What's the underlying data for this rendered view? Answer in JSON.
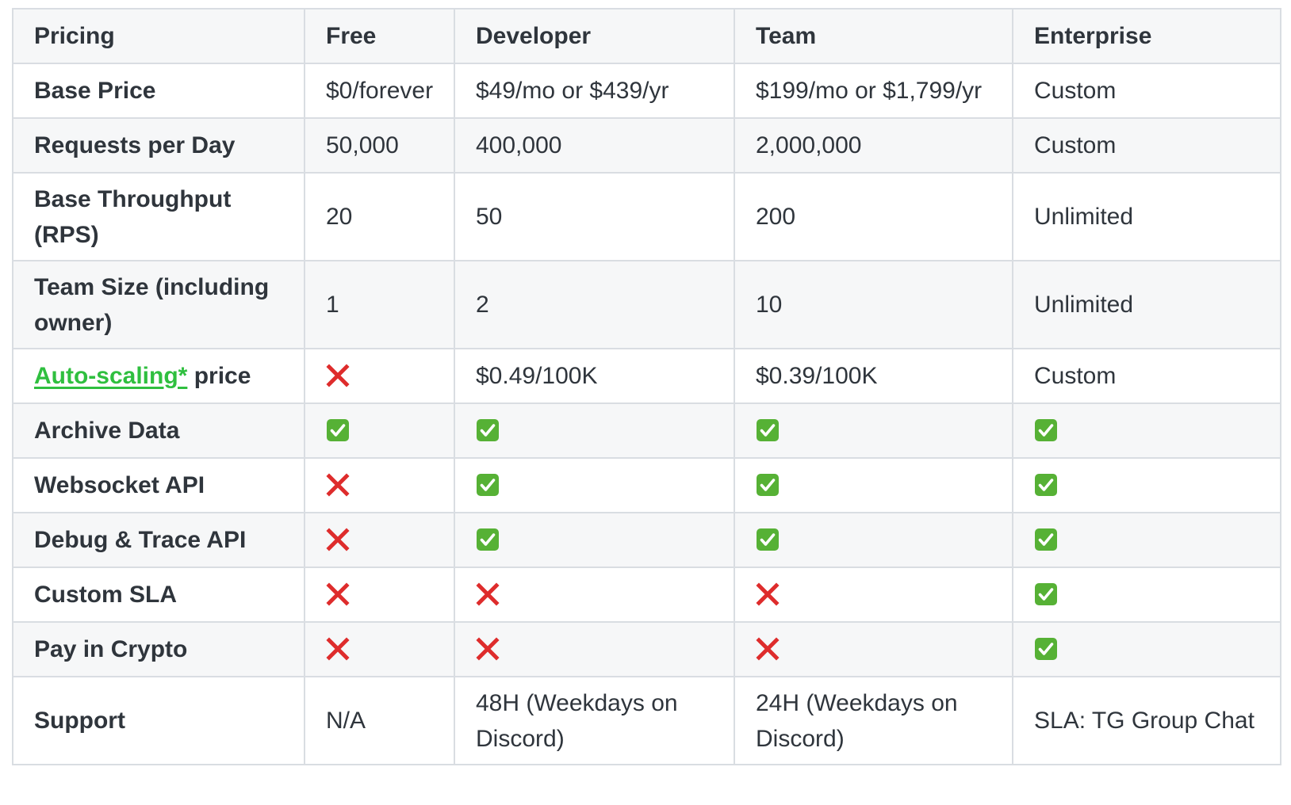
{
  "table": {
    "headers": [
      "Pricing",
      "Free",
      "Developer",
      "Team",
      "Enterprise"
    ],
    "rows": [
      {
        "label": "Base Price",
        "cells": [
          {
            "text": "$0/forever"
          },
          {
            "text": "$49/mo or $439/yr"
          },
          {
            "text": "$199/mo or $1,799/yr"
          },
          {
            "text": "Custom"
          }
        ]
      },
      {
        "label": "Requests per Day",
        "cells": [
          {
            "text": "50,000"
          },
          {
            "text": "400,000"
          },
          {
            "text": "2,000,000"
          },
          {
            "text": "Custom"
          }
        ]
      },
      {
        "label": "Base Throughput (RPS)",
        "cells": [
          {
            "text": "20"
          },
          {
            "text": "50"
          },
          {
            "text": "200"
          },
          {
            "text": "Unlimited"
          }
        ]
      },
      {
        "label": "Team Size (including owner)",
        "cells": [
          {
            "text": "1"
          },
          {
            "text": "2"
          },
          {
            "text": "10"
          },
          {
            "text": "Unlimited"
          }
        ]
      },
      {
        "label_link": "Auto-scaling*",
        "label_suffix": " price",
        "cells": [
          {
            "icon": "cross-mark-icon"
          },
          {
            "text": "$0.49/100K"
          },
          {
            "text": "$0.39/100K"
          },
          {
            "text": "Custom"
          }
        ]
      },
      {
        "label": "Archive Data",
        "cells": [
          {
            "icon": "check-mark-icon"
          },
          {
            "icon": "check-mark-icon"
          },
          {
            "icon": "check-mark-icon"
          },
          {
            "icon": "check-mark-icon"
          }
        ]
      },
      {
        "label": "Websocket API",
        "cells": [
          {
            "icon": "cross-mark-icon"
          },
          {
            "icon": "check-mark-icon"
          },
          {
            "icon": "check-mark-icon"
          },
          {
            "icon": "check-mark-icon"
          }
        ]
      },
      {
        "label": "Debug & Trace API",
        "cells": [
          {
            "icon": "cross-mark-icon"
          },
          {
            "icon": "check-mark-icon"
          },
          {
            "icon": "check-mark-icon"
          },
          {
            "icon": "check-mark-icon"
          }
        ]
      },
      {
        "label": "Custom SLA",
        "cells": [
          {
            "icon": "cross-mark-icon"
          },
          {
            "icon": "cross-mark-icon"
          },
          {
            "icon": "cross-mark-icon"
          },
          {
            "icon": "check-mark-icon"
          }
        ]
      },
      {
        "label": "Pay in Crypto",
        "cells": [
          {
            "icon": "cross-mark-icon"
          },
          {
            "icon": "cross-mark-icon"
          },
          {
            "icon": "cross-mark-icon"
          },
          {
            "icon": "check-mark-icon"
          }
        ]
      },
      {
        "label": "Support",
        "cells": [
          {
            "text": "N/A"
          },
          {
            "text": "48H (Weekdays on Discord)"
          },
          {
            "text": "24H (Weekdays on Discord)"
          },
          {
            "text": "SLA: TG Group Chat"
          }
        ]
      }
    ]
  },
  "colors": {
    "link": "#2fbf3f",
    "check_bg": "#56b135",
    "cross": "#de2c2c",
    "border": "#d9dde2",
    "shaded_row": "#f6f7f8"
  }
}
